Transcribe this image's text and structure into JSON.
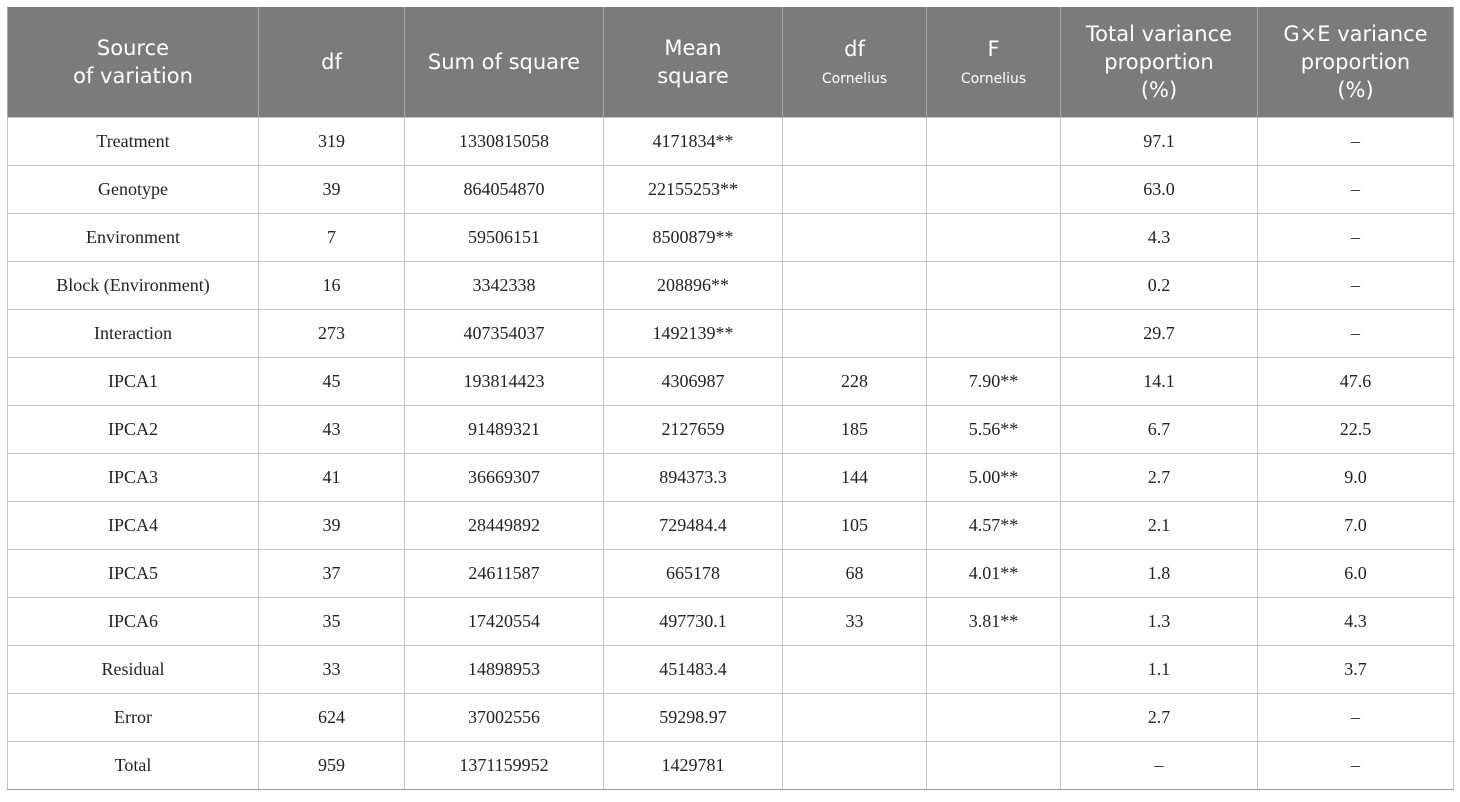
{
  "table": {
    "headers": [
      {
        "lines": [
          "Source",
          "of variation"
        ],
        "sub": ""
      },
      {
        "lines": [
          "df"
        ],
        "sub": ""
      },
      {
        "lines": [
          "Sum of square"
        ],
        "sub": ""
      },
      {
        "lines": [
          "Mean",
          "square"
        ],
        "sub": ""
      },
      {
        "lines": [
          "df"
        ],
        "sub": "Cornelius"
      },
      {
        "lines": [
          "F"
        ],
        "sub": "Cornelius"
      },
      {
        "lines": [
          "Total variance",
          "proportion",
          "(%)"
        ],
        "sub": ""
      },
      {
        "lines": [
          "G×E variance",
          "proportion",
          "(%)"
        ],
        "sub": ""
      }
    ],
    "rows": [
      [
        "Treatment",
        "319",
        "1330815058",
        "4171834**",
        "",
        "",
        "97.1",
        "–"
      ],
      [
        "Genotype",
        "39",
        "864054870",
        "22155253**",
        "",
        "",
        "63.0",
        "–"
      ],
      [
        "Environment",
        "7",
        "59506151",
        "8500879**",
        "",
        "",
        "4.3",
        "–"
      ],
      [
        "Block (Environment)",
        "16",
        "3342338",
        "208896**",
        "",
        "",
        "0.2",
        "–"
      ],
      [
        "Interaction",
        "273",
        "407354037",
        "1492139**",
        "",
        "",
        "29.7",
        "–"
      ],
      [
        "IPCA1",
        "45",
        "193814423",
        "4306987",
        "228",
        "7.90**",
        "14.1",
        "47.6"
      ],
      [
        "IPCA2",
        "43",
        "91489321",
        "2127659",
        "185",
        "5.56**",
        "6.7",
        "22.5"
      ],
      [
        "IPCA3",
        "41",
        "36669307",
        "894373.3",
        "144",
        "5.00**",
        "2.7",
        "9.0"
      ],
      [
        "IPCA4",
        "39",
        "28449892",
        "729484.4",
        "105",
        "4.57**",
        "2.1",
        "7.0"
      ],
      [
        "IPCA5",
        "37",
        "24611587",
        "665178",
        "68",
        "4.01**",
        "1.8",
        "6.0"
      ],
      [
        "IPCA6",
        "35",
        "17420554",
        "497730.1",
        "33",
        "3.81**",
        "1.3",
        "4.3"
      ],
      [
        "Residual",
        "33",
        "14898953",
        "451483.4",
        "",
        "",
        "1.1",
        "3.7"
      ],
      [
        "Error",
        "624",
        "37002556",
        "59298.97",
        "",
        "",
        "2.7",
        "–"
      ],
      [
        "Total",
        "959",
        "1371159952",
        "1429781",
        "",
        "",
        "–",
        "–"
      ]
    ]
  }
}
